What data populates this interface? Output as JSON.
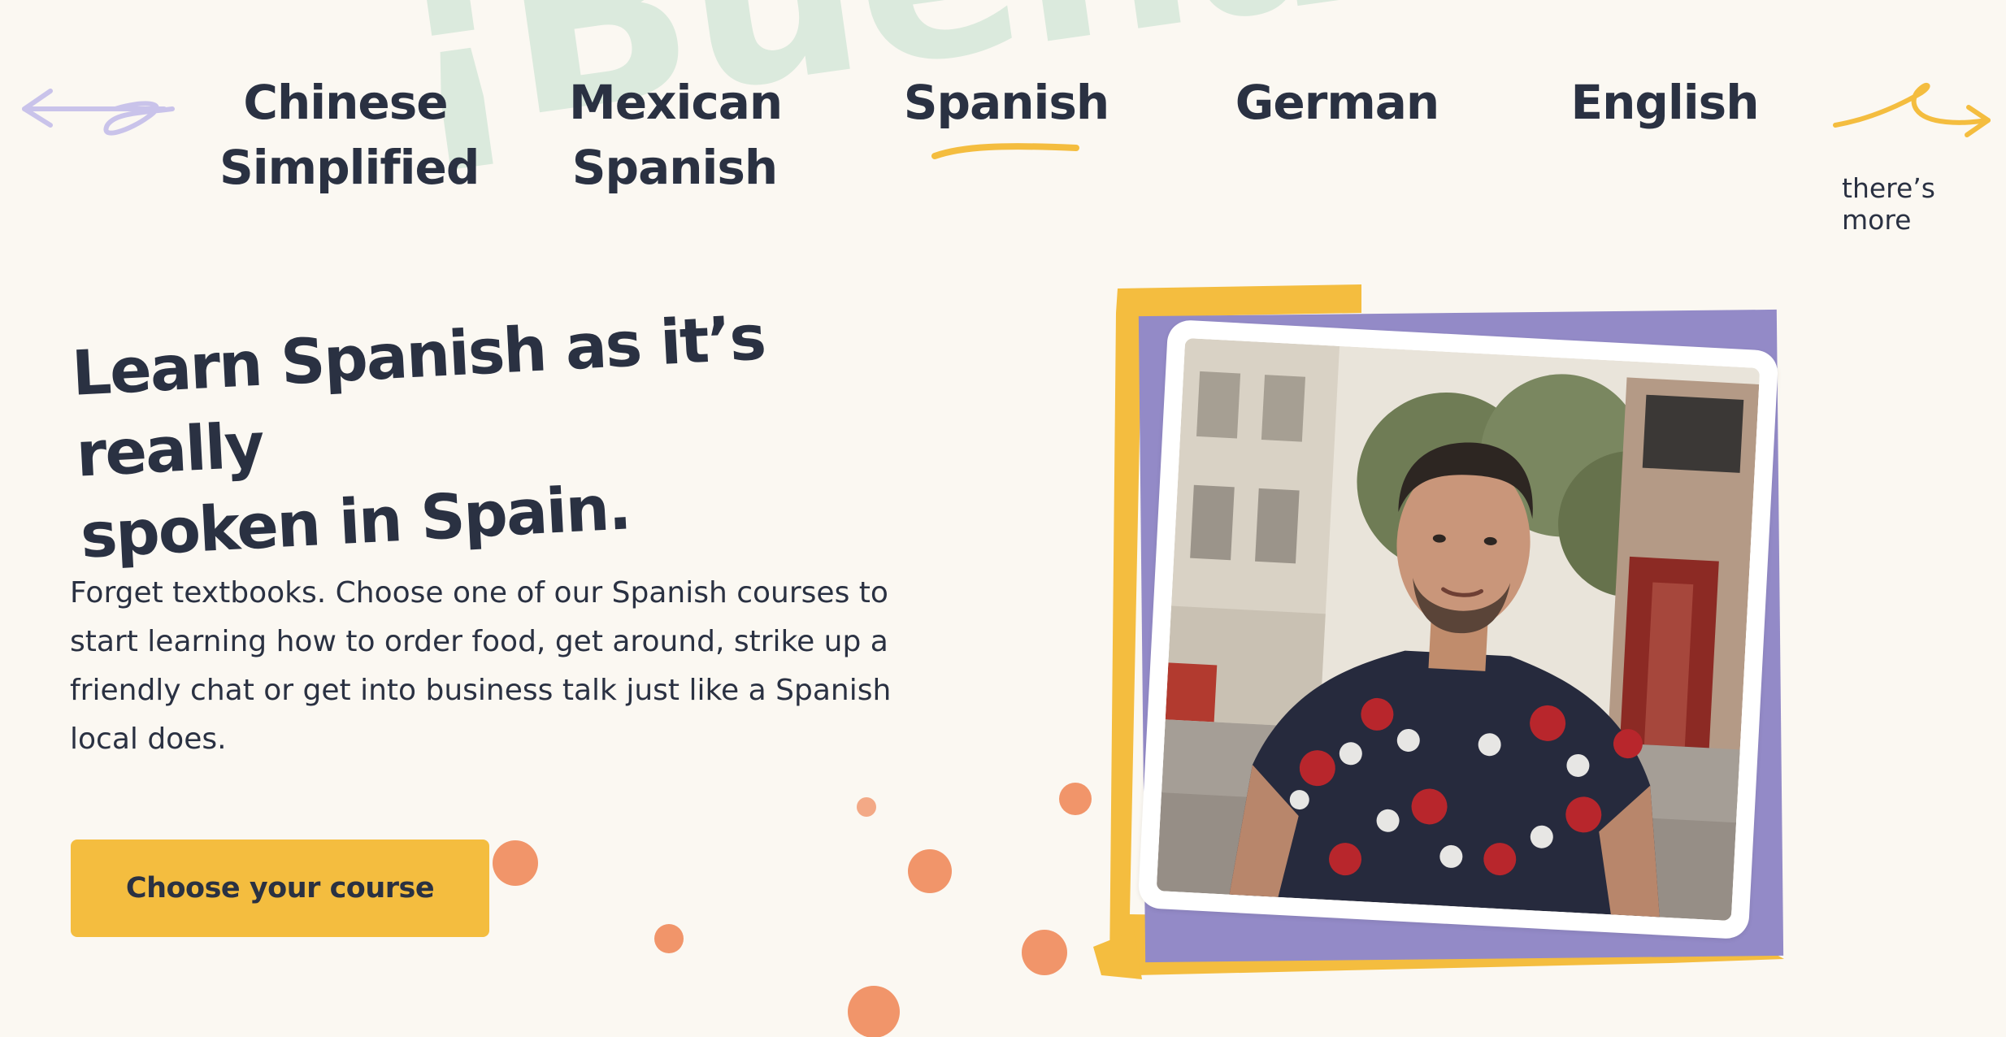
{
  "background_word": "¡Buenas!",
  "tabs": [
    {
      "label": "Chinese Simplified",
      "line1": "Chinese",
      "line2": "Simplified",
      "selected": false
    },
    {
      "label": "Mexican Spanish",
      "line1": "Mexican",
      "line2": "Spanish",
      "selected": false
    },
    {
      "label": "Spanish",
      "line1": "Spanish",
      "line2": "",
      "selected": true
    },
    {
      "label": "German",
      "line1": "German",
      "line2": "",
      "selected": false
    },
    {
      "label": "English",
      "line1": "English",
      "line2": "",
      "selected": false
    }
  ],
  "more_hint": "there’s more",
  "hero": {
    "headline_line1": "Learn Spanish as it’s really",
    "headline_line2": "spoken in Spain.",
    "intro_line1": "Forget textbooks. Choose one of our Spanish courses to",
    "intro_line2": "start learning how to order food, get around, strike up a",
    "intro_line3": "friendly chat or get into business talk just like a Spanish",
    "intro_line4": "local does.",
    "cta_label": "Choose your course"
  },
  "video": {
    "description_icon": "video-still"
  },
  "icons": {
    "left_arrow": "scribble-arrow-left-icon",
    "right_arrow": "scribble-arrow-right-icon"
  },
  "colors": {
    "background": "#fbf8f2",
    "text": "#2a3142",
    "accent_yellow": "#f4bd3f",
    "accent_purple": "#938ac7",
    "splotch_orange": "#f1956a",
    "watermark_green": "#dbeadd",
    "arrow_lavender": "#c9c3ea"
  }
}
